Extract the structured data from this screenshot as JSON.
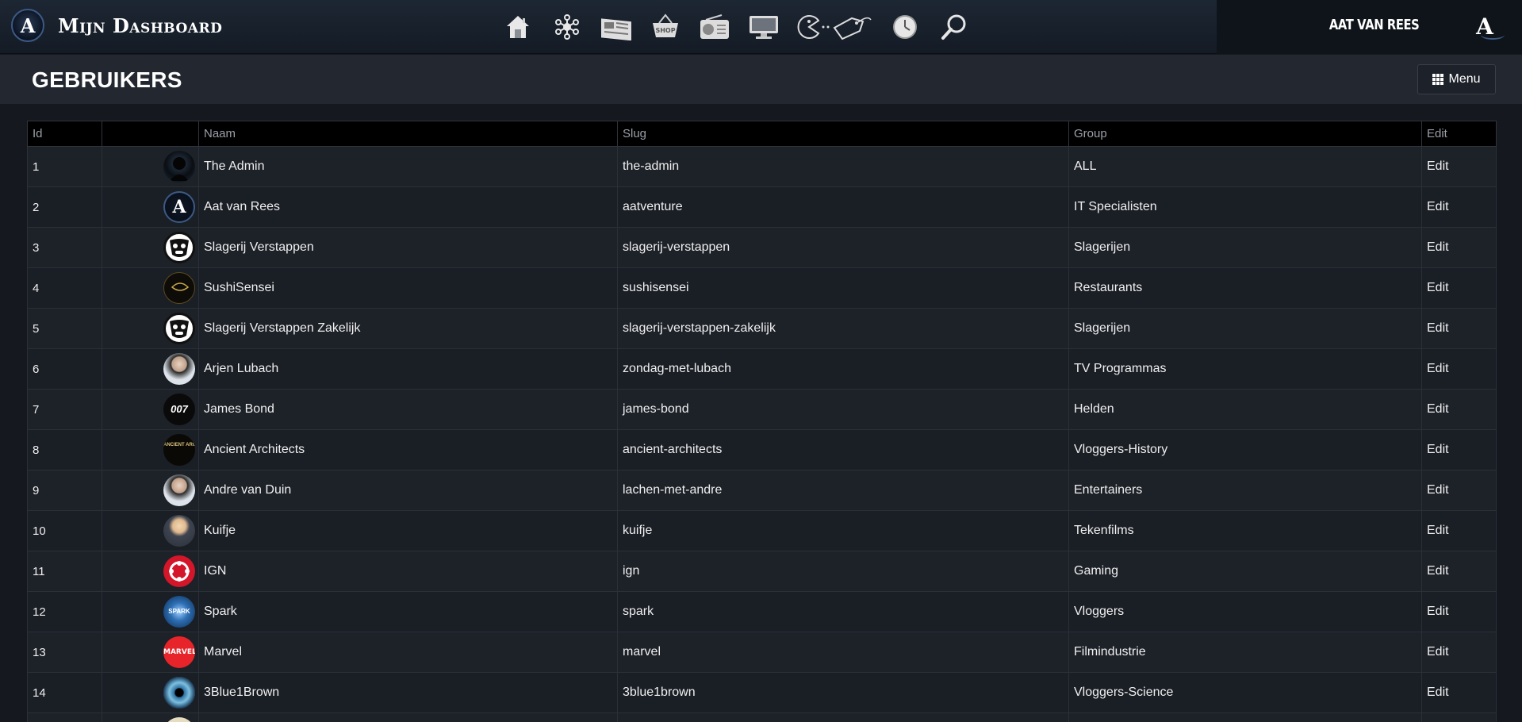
{
  "brand": {
    "logo_letter": "A",
    "title": "Mijn Dashboard"
  },
  "nav_icons": [
    "home-icon",
    "network-icon",
    "newspaper-icon",
    "shop-basket-icon",
    "radio-icon",
    "monitor-icon",
    "pacman-tag-icon",
    "clock-icon",
    "search-icon"
  ],
  "nav_shop_label": "SHOP",
  "user": {
    "name": "AAT VAN REES",
    "logo_letter": "A"
  },
  "page": {
    "title": "GEBRUIKERS",
    "menu_label": "Menu"
  },
  "table": {
    "headers": {
      "id": "Id",
      "avatar": "",
      "name": "Naam",
      "slug": "Slug",
      "group": "Group",
      "edit": "Edit"
    },
    "rows": [
      {
        "id": "1",
        "name": "The Admin",
        "slug": "the-admin",
        "group": "ALL",
        "edit": "Edit",
        "avatar": "admin-silhouette"
      },
      {
        "id": "2",
        "name": "Aat van Rees",
        "slug": "aatventure",
        "group": "IT Specialisten",
        "edit": "Edit",
        "avatar": "aat-logo"
      },
      {
        "id": "3",
        "name": "Slagerij Verstappen",
        "slug": "slagerij-verstappen",
        "group": "Slagerijen",
        "edit": "Edit",
        "avatar": "cow-logo"
      },
      {
        "id": "4",
        "name": "SushiSensei",
        "slug": "sushisensei",
        "group": "Restaurants",
        "edit": "Edit",
        "avatar": "sushi-logo"
      },
      {
        "id": "5",
        "name": "Slagerij Verstappen Zakelijk",
        "slug": "slagerij-verstappen-zakelijk",
        "group": "Slagerijen",
        "edit": "Edit",
        "avatar": "cow-logo"
      },
      {
        "id": "6",
        "name": "Arjen Lubach",
        "slug": "zondag-met-lubach",
        "group": "TV Programmas",
        "edit": "Edit",
        "avatar": "person-photo"
      },
      {
        "id": "7",
        "name": "James Bond",
        "slug": "james-bond",
        "group": "Helden",
        "edit": "Edit",
        "avatar": "007-logo"
      },
      {
        "id": "8",
        "name": "Ancient Architects",
        "slug": "ancient-architects",
        "group": "Vloggers-History",
        "edit": "Edit",
        "avatar": "ancient-architects-logo"
      },
      {
        "id": "9",
        "name": "Andre van Duin",
        "slug": "lachen-met-andre",
        "group": "Entertainers",
        "edit": "Edit",
        "avatar": "person-photo"
      },
      {
        "id": "10",
        "name": "Kuifje",
        "slug": "kuifje",
        "group": "Tekenfilms",
        "edit": "Edit",
        "avatar": "cartoon-photo"
      },
      {
        "id": "11",
        "name": "IGN",
        "slug": "ign",
        "group": "Gaming",
        "edit": "Edit",
        "avatar": "ign-logo"
      },
      {
        "id": "12",
        "name": "Spark",
        "slug": "spark",
        "group": "Vloggers",
        "edit": "Edit",
        "avatar": "spark-logo"
      },
      {
        "id": "13",
        "name": "Marvel",
        "slug": "marvel",
        "group": "Filmindustrie",
        "edit": "Edit",
        "avatar": "marvel-logo"
      },
      {
        "id": "14",
        "name": "3Blue1Brown",
        "slug": "3blue1brown",
        "group": "Vloggers-Science",
        "edit": "Edit",
        "avatar": "eye-logo"
      },
      {
        "id": "",
        "name": "",
        "slug": "",
        "group": "",
        "edit": "",
        "avatar": "partial-avatar"
      }
    ]
  },
  "colors": {
    "topbar": "#1a2230",
    "header_bg": "#23272f",
    "table_head": "#000000",
    "row_bg": "#1a1e25",
    "text": "#f0f0f0",
    "ign_red": "#d3162a",
    "marvel_red": "#e62429"
  }
}
